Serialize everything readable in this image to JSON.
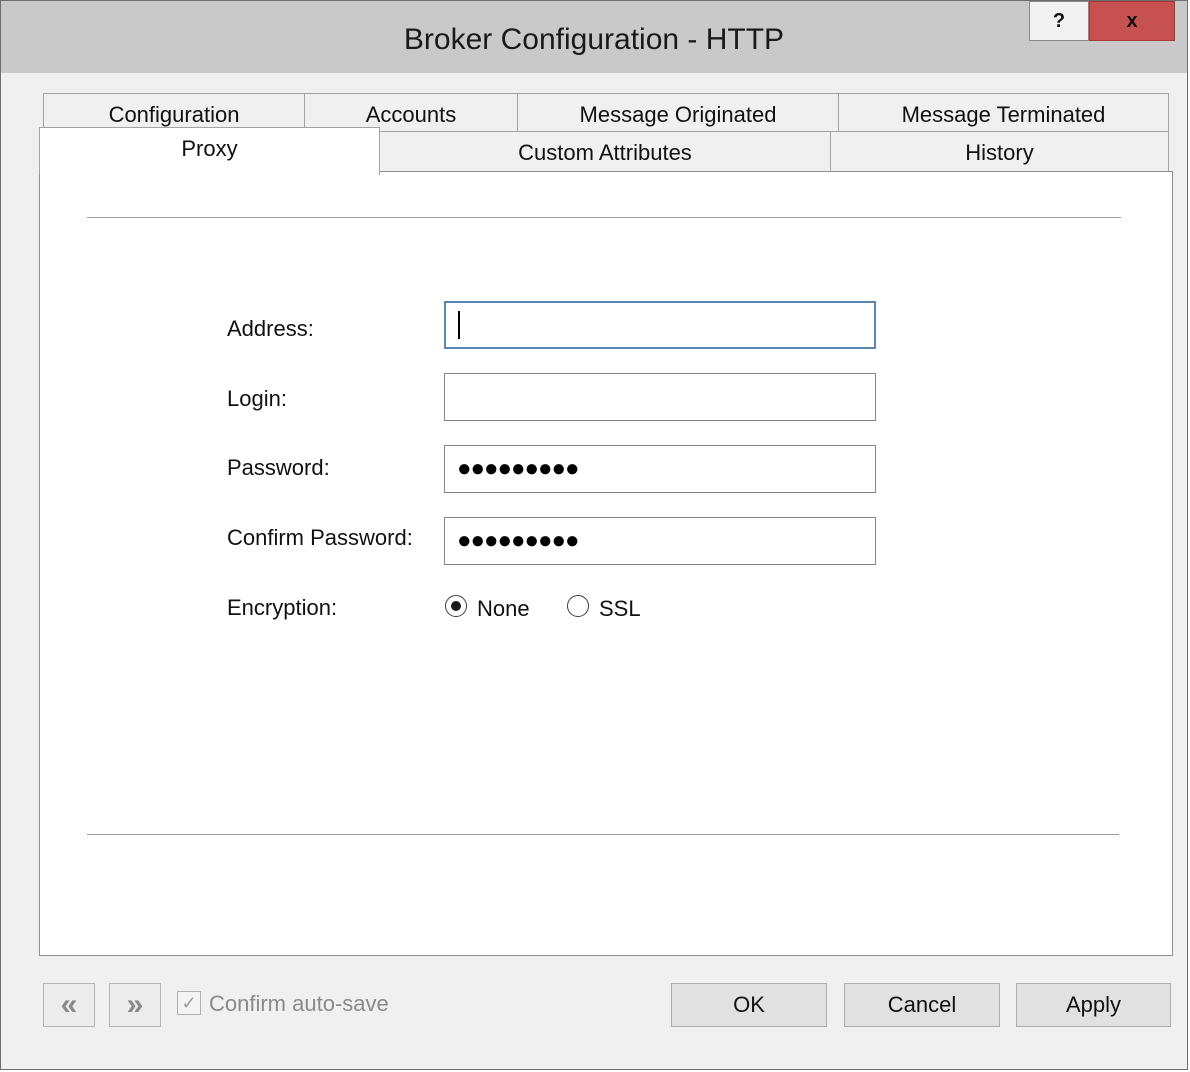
{
  "window": {
    "title": "Broker Configuration - HTTP",
    "help_label": "?",
    "close_label": "x"
  },
  "tabs": {
    "row1": [
      "Configuration",
      "Accounts",
      "Message Originated",
      "Message Terminated"
    ],
    "row2": [
      "Proxy",
      "Custom Attributes",
      "History"
    ],
    "active": "Proxy"
  },
  "form": {
    "address_label": "Address:",
    "address_value": "",
    "login_label": "Login:",
    "login_value": "",
    "password_label": "Password:",
    "password_mask": "●●●●●●●●●",
    "confirm_label": "Confirm Password:",
    "confirm_mask": "●●●●●●●●●",
    "encryption_label": "Encryption:",
    "encryption_options": [
      "None",
      "SSL"
    ],
    "encryption_selected": "None"
  },
  "footer": {
    "prev_icon": "«",
    "next_icon": "»",
    "check_icon": "✓",
    "confirm_autosave_label": "Confirm auto-save",
    "confirm_autosave_checked": true,
    "ok_label": "OK",
    "cancel_label": "Cancel",
    "apply_label": "Apply"
  },
  "colors": {
    "title_bar": "#c9c9c9",
    "close_button": "#c75050",
    "focus_border": "#5a86b4"
  }
}
